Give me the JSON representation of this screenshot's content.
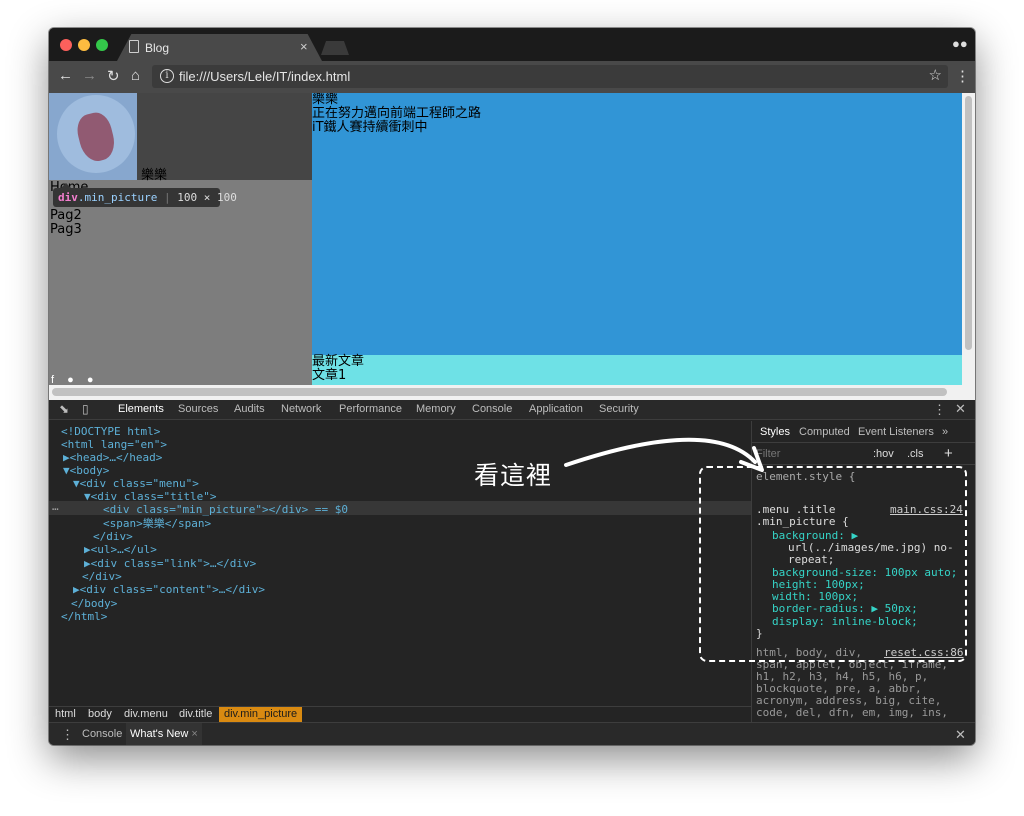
{
  "browser": {
    "tab_title": "Blog",
    "tab_close": "×",
    "url": "file:///Users/Lele/IT/index.html",
    "nav_icons": [
      "back-icon",
      "forward-icon",
      "reload-icon",
      "home-icon",
      "info-icon",
      "star-icon",
      "more-icon",
      "incognito-icon"
    ]
  },
  "page": {
    "span_name": "樂樂",
    "menu_items": [
      "Home",
      "Pag2",
      "Pag3"
    ],
    "content_lines": [
      "樂樂",
      "正在努力邁向前端工程師之路",
      "iT鐵人賽持續衝刺中"
    ],
    "articles_title": "最新文章",
    "article1": "文章1",
    "tooltip_tag": "div",
    "tooltip_class": ".min_picture",
    "tooltip_size": "100 × 100"
  },
  "devtools": {
    "tabs": [
      "Elements",
      "Sources",
      "Audits",
      "Network",
      "Performance",
      "Memory",
      "Console",
      "Application",
      "Security"
    ],
    "active_tab": "Elements",
    "dom_lines": [
      "<!DOCTYPE html>",
      "<html lang=\"en\">",
      "▶<head>…</head>",
      "▼<body>",
      "▼<div class=\"menu\">",
      "▼<div class=\"title\">",
      "<div class=\"min_picture\"></div> == $0",
      "<span>樂樂</span>",
      "</div>",
      "▶<ul>…</ul>",
      "▶<div class=\"link\">…</div>",
      "</div>",
      "▶<div class=\"content\">…</div>",
      "</body>",
      "</html>"
    ],
    "breadcrumbs": [
      "html",
      "body",
      "div.menu",
      "div.title",
      "div.min_picture"
    ],
    "styles_tabs": [
      "Styles",
      "Computed",
      "Event Listeners",
      "»"
    ],
    "filter_placeholder": "Filter",
    "hov": ":hov",
    "cls": ".cls",
    "plus": "+",
    "element_style": "element.style {",
    "rule_selector_1": ".menu .title",
    "rule_selector_2": ".min_picture {",
    "rule_source": "main.css:24",
    "rule_lines": [
      "background: ▶",
      "url(../images/me.jpg) no-",
      "repeat;",
      "background-size: 100px auto;",
      "height: 100px;",
      "width: 100px;",
      "border-radius: ▶ 50px;",
      "display: inline-block;"
    ],
    "rule_close": "}",
    "reset_selector": "html, body, div,",
    "reset_source": "reset.css:86",
    "reset_lines": [
      "span, applet, object, iframe,",
      "h1, h2, h3, h4, h5, h6, p,",
      "blockquote, pre, a, abbr,",
      "acronym, address, big, cite,",
      "code, del, dfn, em, img, ins,"
    ],
    "drawer_tabs": [
      "Console",
      "What's New"
    ],
    "drawer_close": "×"
  },
  "annotation": "看這裡",
  "colors": {
    "menu_bg": "#7d7d7d",
    "title_bg": "#454545",
    "content_bg": "#3195d6",
    "articles_bg": "#6ee1e6",
    "breadcrumb_active": "#d98a11",
    "tag_color": "#5db0d7",
    "property_color": "#35d4c7"
  }
}
